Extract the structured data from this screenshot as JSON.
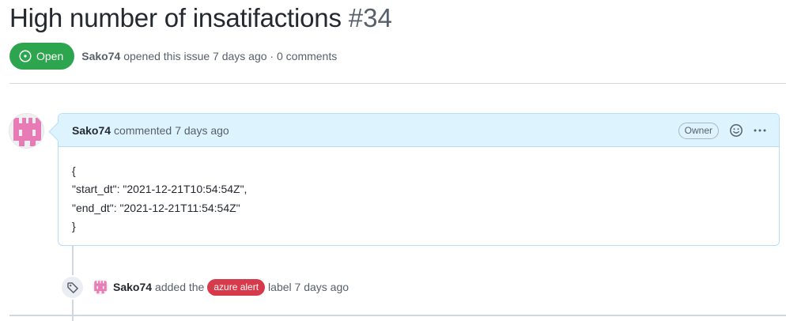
{
  "issue": {
    "title": "High number of insatifactions",
    "number": "#34",
    "state": "Open",
    "author": "Sako74",
    "meta_text": "opened this issue 7 days ago · 0 comments"
  },
  "comment": {
    "author": "Sako74",
    "action": "commented",
    "time": "7 days ago",
    "role_badge": "Owner",
    "body_lines": [
      "{",
      "\"start_dt\": \"2021-12-21T10:54:54Z\",",
      "\"end_dt\": \"2021-12-21T11:54:54Z\"",
      "}"
    ]
  },
  "event": {
    "author": "Sako74",
    "text_before": "added the",
    "label": "azure alert",
    "text_after": "label 7 days ago"
  },
  "colors": {
    "open_green": "#2da44e",
    "label_red": "#d73a4a",
    "header_blue": "#ddf4ff",
    "avatar_pink": "#e87bb5"
  },
  "icons": {
    "state": "issue-opened-icon",
    "reaction": "smiley-icon",
    "more": "kebab-horizontal-icon",
    "event": "tag-icon"
  }
}
